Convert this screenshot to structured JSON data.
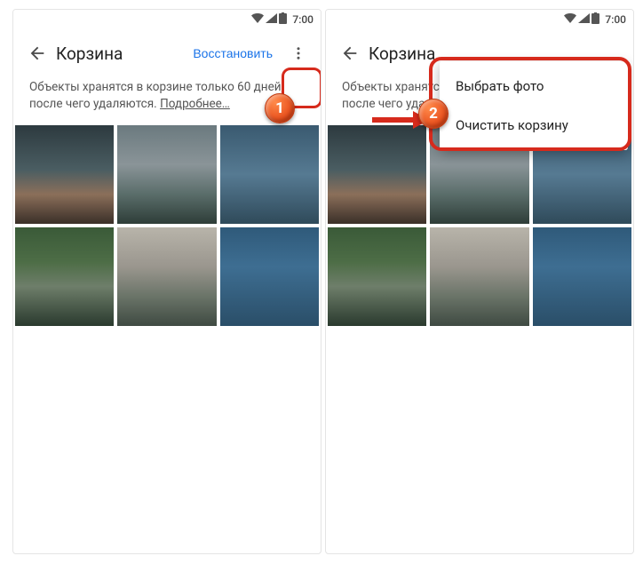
{
  "statusbar": {
    "time": "7:00"
  },
  "appbar": {
    "title": "Корзина",
    "restore": "Восстановить"
  },
  "info": {
    "line1": "Объекты хранятся в корзине только 60 дней,",
    "line2": "после чего удаляются.  ",
    "more": "Подробнее…"
  },
  "menu": {
    "select": "Выбрать фото",
    "empty": "Очистить корзину"
  },
  "markers": {
    "m1": "1",
    "m2": "2"
  }
}
